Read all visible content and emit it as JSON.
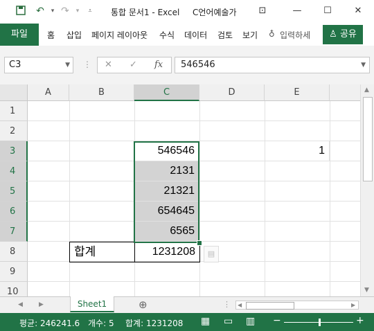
{
  "titlebar": {
    "title": "통합 문서1  -  Excel",
    "user": "C언어예술가",
    "save_icon": "save-icon",
    "undo_icon": "undo-icon",
    "redo_icon": "redo-icon"
  },
  "ribbon": {
    "file": "파일",
    "tabs": [
      "홈",
      "삽입",
      "페이지 레이아웃",
      "수식",
      "데이터",
      "검토",
      "보기"
    ],
    "tell_me": "입력하세",
    "share": "공유"
  },
  "formula_bar": {
    "name_box": "C3",
    "formula": "546546"
  },
  "grid": {
    "columns": [
      "A",
      "B",
      "C",
      "D",
      "E"
    ],
    "rows": [
      "1",
      "2",
      "3",
      "4",
      "5",
      "6",
      "7",
      "8",
      "9",
      "10"
    ],
    "cells": {
      "C3": "546546",
      "E3": "1",
      "C4": "2131",
      "C5": "21321",
      "C6": "654645",
      "C7": "6565",
      "B8": "합계",
      "C8": "1231208"
    }
  },
  "sheet_tabs": {
    "active": "Sheet1"
  },
  "status": {
    "average": "평균: 246241.6",
    "count": "개수: 5",
    "sum": "합계: 1231208"
  },
  "colors": {
    "accent": "#217346",
    "selection_fill": "#d3d3d3"
  }
}
